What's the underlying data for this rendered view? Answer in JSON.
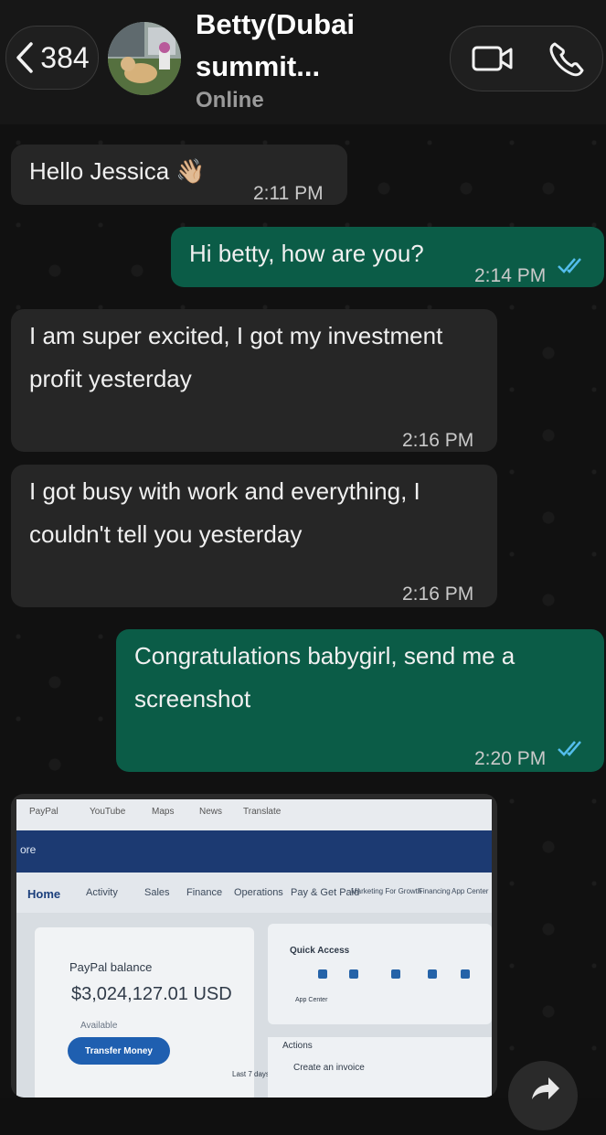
{
  "header": {
    "back_count": "384",
    "contact_name": "Betty(Dubai summit...",
    "status": "Online",
    "video_call_icon": "video-camera-icon",
    "voice_call_icon": "phone-icon"
  },
  "messages": [
    {
      "direction": "in",
      "text": "Hello Jessica 👋🏼",
      "time": "2:11 PM"
    },
    {
      "direction": "out",
      "text": "Hi betty, how are you?",
      "time": "2:14 PM",
      "read": true
    },
    {
      "direction": "in",
      "text": "I am super excited, I got my investment profit yesterday",
      "time": "2:16 PM"
    },
    {
      "direction": "in",
      "text": "I got busy with work and everything, I couldn't tell you yesterday",
      "time": "2:16 PM"
    },
    {
      "direction": "out",
      "text": "Congratulations babygirl, send me a screenshot",
      "time": "2:20 PM",
      "read": true
    }
  ],
  "photo": {
    "browser_tabs": [
      "PayPal",
      "YouTube",
      "Maps",
      "News",
      "Translate"
    ],
    "brand_fragment": "ore",
    "menu": [
      "Home",
      "Activity",
      "Sales",
      "Finance",
      "Operations",
      "Pay & Get Paid",
      "Marketing For Growth",
      "Financing",
      "App Center"
    ],
    "balance_title": "PayPal balance",
    "balance_amount": "$3,024,127.01 USD",
    "balance_sub": "Available",
    "transfer_label": "Transfer Money",
    "quick_access": "Quick Access",
    "app_center": "App Center",
    "actions": "Actions",
    "create_invoice": "Create an invoice",
    "last_days": "Last 7 days"
  },
  "colors": {
    "incoming": "#262626",
    "outgoing": "#0b5c47",
    "read_ticks": "#53bdeb"
  }
}
